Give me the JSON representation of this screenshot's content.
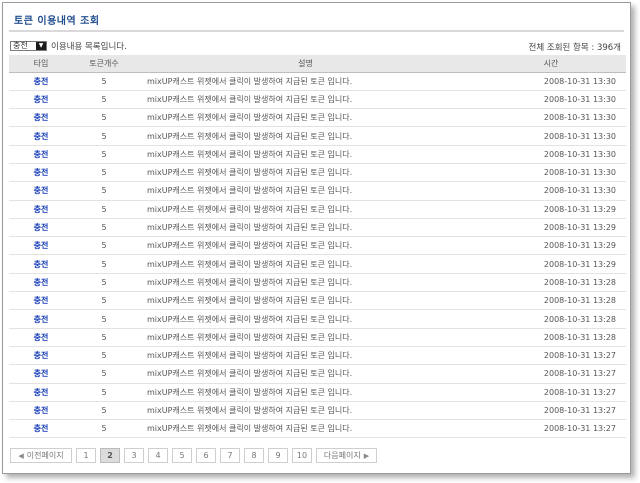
{
  "header": {
    "title": "토큰 이용내역 조회"
  },
  "filter": {
    "selected": "충전",
    "description": "이용내용 목록입니다."
  },
  "summary": {
    "total_text": "전체 조회된 항목 : 396개"
  },
  "table": {
    "columns": [
      "타입",
      "토큰개수",
      "설명",
      "시간"
    ],
    "rows": [
      {
        "type": "충전",
        "count": "5",
        "desc": "mixUP캐스트 위젯에서 클릭이 발생하여 지급된 토큰 입니다.",
        "time": "2008-10-31 13:30"
      },
      {
        "type": "충전",
        "count": "5",
        "desc": "mixUP캐스트 위젯에서 클릭이 발생하여 지급된 토큰 입니다.",
        "time": "2008-10-31 13:30"
      },
      {
        "type": "충전",
        "count": "5",
        "desc": "mixUP캐스트 위젯에서 클릭이 발생하여 지급된 토큰 입니다.",
        "time": "2008-10-31 13:30"
      },
      {
        "type": "충전",
        "count": "5",
        "desc": "mixUP캐스트 위젯에서 클릭이 발생하여 지급된 토큰 입니다.",
        "time": "2008-10-31 13:30"
      },
      {
        "type": "충전",
        "count": "5",
        "desc": "mixUP캐스트 위젯에서 클릭이 발생하여 지급된 토큰 입니다.",
        "time": "2008-10-31 13:30"
      },
      {
        "type": "충전",
        "count": "5",
        "desc": "mixUP캐스트 위젯에서 클릭이 발생하여 지급된 토큰 입니다.",
        "time": "2008-10-31 13:30"
      },
      {
        "type": "충전",
        "count": "5",
        "desc": "mixUP캐스트 위젯에서 클릭이 발생하여 지급된 토큰 입니다.",
        "time": "2008-10-31 13:30"
      },
      {
        "type": "충전",
        "count": "5",
        "desc": "mixUP캐스트 위젯에서 클릭이 발생하여 지급된 토큰 입니다.",
        "time": "2008-10-31 13:29"
      },
      {
        "type": "충전",
        "count": "5",
        "desc": "mixUP캐스트 위젯에서 클릭이 발생하여 지급된 토큰 입니다.",
        "time": "2008-10-31 13:29"
      },
      {
        "type": "충전",
        "count": "5",
        "desc": "mixUP캐스트 위젯에서 클릭이 발생하여 지급된 토큰 입니다.",
        "time": "2008-10-31 13:29"
      },
      {
        "type": "충전",
        "count": "5",
        "desc": "mixUP캐스트 위젯에서 클릭이 발생하여 지급된 토큰 입니다.",
        "time": "2008-10-31 13:29"
      },
      {
        "type": "충전",
        "count": "5",
        "desc": "mixUP캐스트 위젯에서 클릭이 발생하여 지급된 토큰 입니다.",
        "time": "2008-10-31 13:28"
      },
      {
        "type": "충전",
        "count": "5",
        "desc": "mixUP캐스트 위젯에서 클릭이 발생하여 지급된 토큰 입니다.",
        "time": "2008-10-31 13:28"
      },
      {
        "type": "충전",
        "count": "5",
        "desc": "mixUP캐스트 위젯에서 클릭이 발생하여 지급된 토큰 입니다.",
        "time": "2008-10-31 13:28"
      },
      {
        "type": "충전",
        "count": "5",
        "desc": "mixUP캐스트 위젯에서 클릭이 발생하여 지급된 토큰 입니다.",
        "time": "2008-10-31 13:28"
      },
      {
        "type": "충전",
        "count": "5",
        "desc": "mixUP캐스트 위젯에서 클릭이 발생하여 지급된 토큰 입니다.",
        "time": "2008-10-31 13:27"
      },
      {
        "type": "충전",
        "count": "5",
        "desc": "mixUP캐스트 위젯에서 클릭이 발생하여 지급된 토큰 입니다.",
        "time": "2008-10-31 13:27"
      },
      {
        "type": "충전",
        "count": "5",
        "desc": "mixUP캐스트 위젯에서 클릭이 발생하여 지급된 토큰 입니다.",
        "time": "2008-10-31 13:27"
      },
      {
        "type": "충전",
        "count": "5",
        "desc": "mixUP캐스트 위젯에서 클릭이 발생하여 지급된 토큰 입니다.",
        "time": "2008-10-31 13:27"
      },
      {
        "type": "충전",
        "count": "5",
        "desc": "mixUP캐스트 위젯에서 클릭이 발생하여 지급된 토큰 입니다.",
        "time": "2008-10-31 13:27"
      }
    ]
  },
  "pagination": {
    "prev_label": "이전페이지",
    "next_label": "다음페이지",
    "pages": [
      "1",
      "2",
      "3",
      "4",
      "5",
      "6",
      "7",
      "8",
      "9",
      "10"
    ],
    "current": "2"
  },
  "icons": {
    "prev": "triangle-left-icon",
    "next": "triangle-right-icon",
    "dropdown": "chevron-down-icon"
  },
  "colors": {
    "title": "#23508f",
    "type_link": "#1a3fb8",
    "header_bg": "#e8e8e8"
  }
}
